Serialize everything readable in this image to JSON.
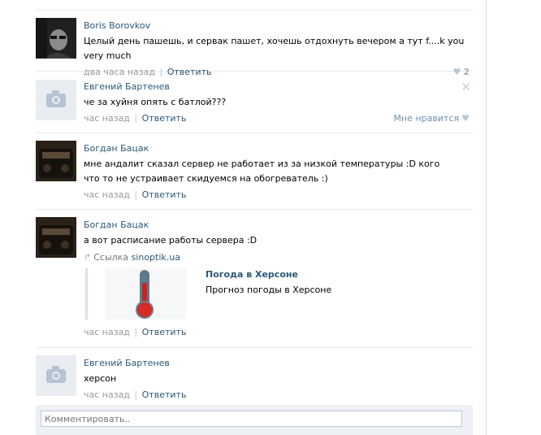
{
  "comments": [
    {
      "author": "Boris Borovkov",
      "text": "Целый день пашешь, и сервак пашет, хочешь отдохнуть вечером а тут f....k you very much",
      "time": "два часа назад",
      "reply": "Ответить",
      "likes_count": "2"
    },
    {
      "author": "Евгений Бартенев",
      "text": "че за хуйня опять с батлой???",
      "time": "час назад",
      "reply": "Ответить",
      "like_label": "Мне нравится"
    },
    {
      "author": "Богдан Бацак",
      "text": "мне андалит сказал сервер не работает из за низкой температуры :D кого что то не устраивает скидуемся на обогреватель :)",
      "time": "час назад",
      "reply": "Ответить"
    },
    {
      "author": "Богдан Бацак",
      "text": "а вот расписание работы сервера :D",
      "link_label": "Ссылка",
      "link_domain": "sinoptik.ua",
      "snippet_title": "Погода в Херсоне",
      "snippet_desc": "Прогноз погоды в Херсоне",
      "time": "час назад",
      "reply": "Ответить"
    },
    {
      "author": "Евгений Бартенев",
      "text": "херсон",
      "time": "час назад",
      "reply": "Ответить"
    }
  ],
  "composer": {
    "placeholder": "Комментировать.."
  },
  "icons": {
    "like": "heart-icon",
    "delete": "close-icon",
    "link": "link-arrow-icon",
    "camera": "camera-icon"
  },
  "colors": {
    "link": "#2b587a",
    "meta": "#999999",
    "divider": "#e7eaed",
    "composer_bg": "#edf1f5"
  }
}
